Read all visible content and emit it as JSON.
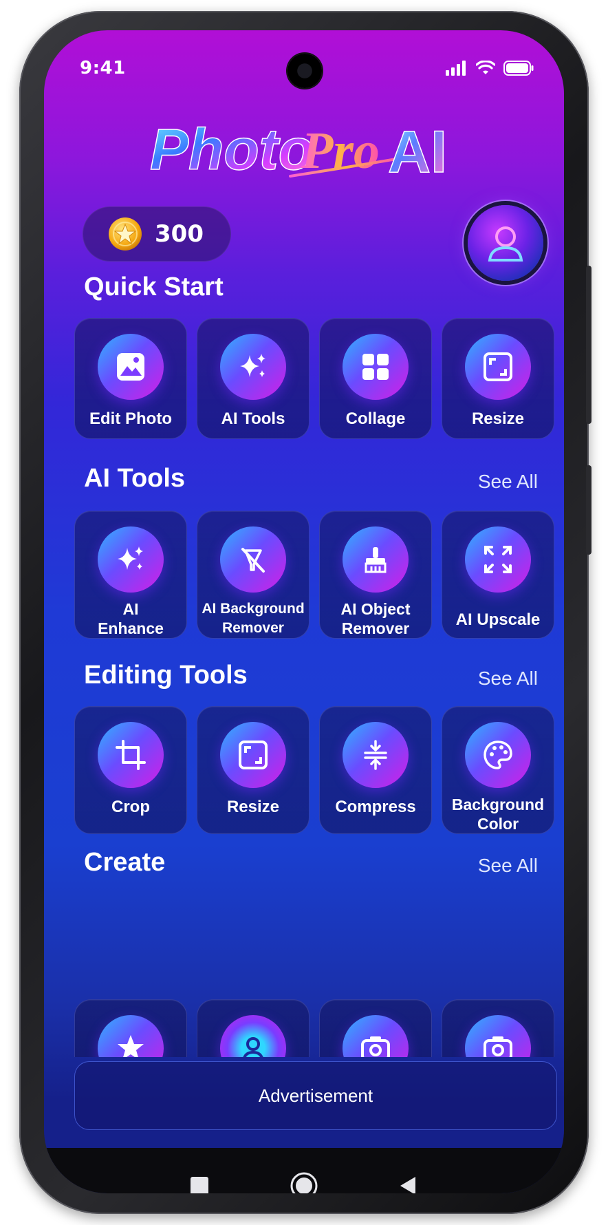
{
  "status_bar": {
    "time": "9:41",
    "icons": [
      "signal-icon",
      "wifi-icon",
      "battery-icon"
    ]
  },
  "app": {
    "logo_text": "PhotoPro AI"
  },
  "coins": {
    "count": "300",
    "icon": "star-coin-icon"
  },
  "profile": {
    "icon": "user-avatar-icon"
  },
  "quick_start": {
    "title": "Quick Start",
    "items": [
      {
        "label": "Edit Photo",
        "icon": "image-icon"
      },
      {
        "label": "AI Tools",
        "icon": "sparkles-icon"
      },
      {
        "label": "Collage",
        "icon": "grid-icon"
      },
      {
        "label": "Resize",
        "icon": "resize-icon"
      }
    ]
  },
  "ai_tools": {
    "title": "AI Tools",
    "see_all": "See All",
    "items": [
      {
        "label_line1": "AI",
        "label_line2": "Enhance",
        "icon": "sparkles-icon"
      },
      {
        "label_line1": "AI Background",
        "label_line2": "Remover",
        "icon": "background-remove-icon"
      },
      {
        "label_line1": "AI Object",
        "label_line2": "Remover",
        "icon": "brush-icon"
      },
      {
        "label": "AI Upscale",
        "icon": "expand-icon"
      }
    ]
  },
  "editing_tools": {
    "title": "Editing Tools",
    "see_all": "See All",
    "items": [
      {
        "label": "Crop",
        "icon": "crop-icon"
      },
      {
        "label": "Resize",
        "icon": "resize-icon"
      },
      {
        "label": "Compress",
        "icon": "compress-icon"
      },
      {
        "label_line1": "Background",
        "label_line2": "Color",
        "icon": "palette-icon"
      }
    ]
  },
  "create": {
    "title": "Create",
    "see_all": "See All",
    "items": [
      {
        "icon": "star-icon"
      },
      {
        "icon": "person-icon"
      },
      {
        "icon": "camera-icon"
      },
      {
        "icon": "camera-icon"
      }
    ]
  },
  "advertisement": {
    "label": "Advertisement"
  },
  "navigation": {
    "buttons": [
      "recents-button",
      "home-button",
      "back-button"
    ]
  },
  "colors": {
    "gradient_top": "#b10fd6",
    "gradient_bottom": "#15208a",
    "icon_gradient_start": "#2fb6ff",
    "icon_gradient_end": "#d21ee6"
  }
}
